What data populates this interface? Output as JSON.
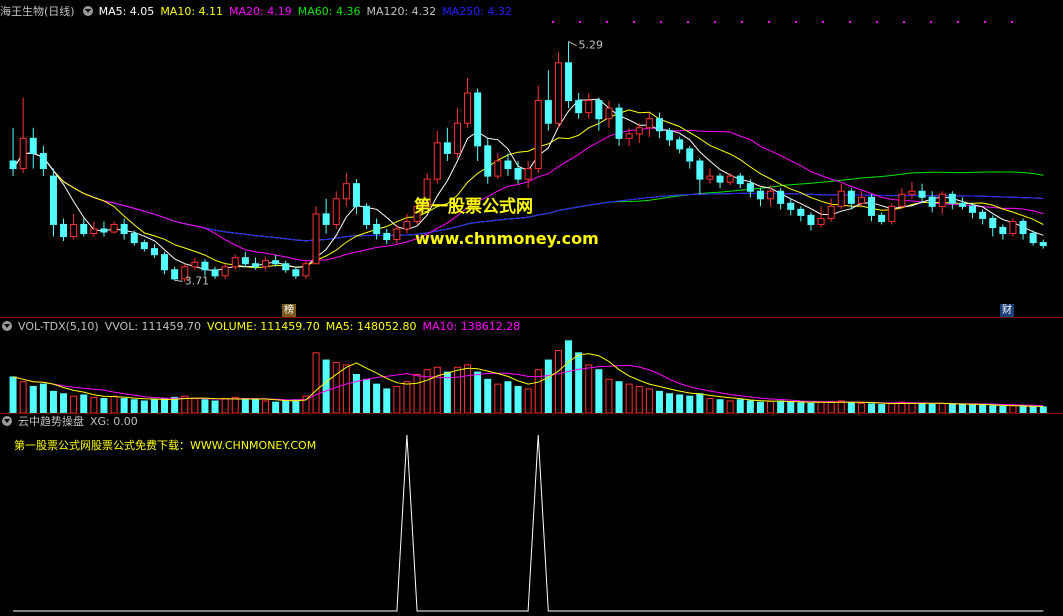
{
  "main_header": {
    "stock_name": "海王生物(日线)",
    "ma5": "MA5: 4.05",
    "ma10": "MA10: 4.11",
    "ma20": "MA20: 4.19",
    "ma60": "MA60: 4.36",
    "ma120": "MA120: 4.32",
    "ma250": "MA250: 4.32"
  },
  "volume_header": {
    "indicator": "VOL-TDX(5,10)",
    "vvol": "VVOL: 111459.70",
    "volume": "VOLUME: 111459.70",
    "ma5": "MA5: 148052.80",
    "ma10": "MA10: 138612.28"
  },
  "signal_header": {
    "indicator": "云中趋势操盘",
    "xg": "XG: 0.00",
    "promo": "第一股票公式网股票公式免费下载：WWW.CHNMONEY.COM"
  },
  "watermark": {
    "title": "第一股票公式网",
    "url": "www.chnmoney.com"
  },
  "tags": {
    "bang": "榜",
    "cai": "财"
  },
  "colors": {
    "up": "#ff3232",
    "down": "#54ffff",
    "ma5": "#ffffff",
    "ma10": "#ffff00",
    "ma20": "#ff00ff",
    "ma60": "#00e600",
    "ma120": "#c0c0c0",
    "ma250": "#2020ff",
    "divider": "#7a0000"
  },
  "chart_data": [
    {
      "type": "candlestick",
      "price_range": [
        3.58,
        5.42
      ],
      "annotations": [
        {
          "label": "5.29",
          "index": 55,
          "value": 5.29
        },
        {
          "label": "3.71",
          "index": 16,
          "value": 3.71
        }
      ],
      "candles": [
        [
          4.5,
          4.45,
          4.72,
          4.4
        ],
        [
          4.45,
          4.65,
          4.92,
          4.42
        ],
        [
          4.65,
          4.55,
          4.72,
          4.45
        ],
        [
          4.55,
          4.45,
          4.6,
          4.4
        ],
        [
          4.4,
          4.08,
          4.45,
          4.0
        ],
        [
          4.08,
          4.0,
          4.12,
          3.97
        ],
        [
          4.0,
          4.08,
          4.15,
          3.98
        ],
        [
          4.08,
          4.02,
          4.12,
          4.0
        ],
        [
          4.02,
          4.05,
          4.1,
          4.0
        ],
        [
          4.05,
          4.03,
          4.1,
          4.0
        ],
        [
          4.03,
          4.08,
          4.1,
          4.02
        ],
        [
          4.08,
          4.02,
          4.12,
          3.98
        ],
        [
          4.02,
          3.96,
          4.04,
          3.94
        ],
        [
          3.96,
          3.92,
          3.98,
          3.9
        ],
        [
          3.92,
          3.88,
          3.95,
          3.86
        ],
        [
          3.88,
          3.78,
          3.9,
          3.75
        ],
        [
          3.78,
          3.72,
          3.8,
          3.71
        ],
        [
          3.72,
          3.8,
          3.82,
          3.7
        ],
        [
          3.8,
          3.83,
          3.86,
          3.78
        ],
        [
          3.83,
          3.78,
          3.85,
          3.74
        ],
        [
          3.78,
          3.74,
          3.8,
          3.72
        ],
        [
          3.74,
          3.8,
          3.82,
          3.72
        ],
        [
          3.8,
          3.86,
          3.88,
          3.78
        ],
        [
          3.86,
          3.82,
          3.9,
          3.8
        ],
        [
          3.82,
          3.8,
          3.86,
          3.78
        ],
        [
          3.8,
          3.84,
          3.86,
          3.78
        ],
        [
          3.84,
          3.82,
          3.88,
          3.8
        ],
        [
          3.82,
          3.78,
          3.84,
          3.76
        ],
        [
          3.78,
          3.74,
          3.8,
          3.72
        ],
        [
          3.74,
          3.82,
          3.84,
          3.72
        ],
        [
          3.82,
          4.15,
          4.2,
          3.82
        ],
        [
          4.15,
          4.08,
          4.25,
          4.02
        ],
        [
          4.08,
          4.25,
          4.3,
          4.05
        ],
        [
          4.25,
          4.35,
          4.42,
          4.2
        ],
        [
          4.35,
          4.2,
          4.38,
          4.15
        ],
        [
          4.2,
          4.08,
          4.22,
          4.05
        ],
        [
          4.08,
          4.02,
          4.12,
          3.98
        ],
        [
          4.02,
          3.98,
          4.05,
          3.95
        ],
        [
          3.98,
          4.05,
          4.08,
          3.95
        ],
        [
          4.05,
          4.1,
          4.15,
          4.02
        ],
        [
          4.1,
          4.2,
          4.25,
          4.08
        ],
        [
          4.2,
          4.38,
          4.42,
          4.18
        ],
        [
          4.38,
          4.62,
          4.7,
          4.35
        ],
        [
          4.62,
          4.55,
          4.72,
          4.5
        ],
        [
          4.55,
          4.75,
          4.85,
          4.52
        ],
        [
          4.75,
          4.95,
          5.05,
          4.72
        ],
        [
          4.95,
          4.6,
          4.98,
          4.5
        ],
        [
          4.6,
          4.4,
          4.65,
          4.35
        ],
        [
          4.4,
          4.5,
          4.55,
          4.38
        ],
        [
          4.5,
          4.45,
          4.55,
          4.4
        ],
        [
          4.45,
          4.38,
          4.5,
          4.35
        ],
        [
          4.38,
          4.45,
          4.5,
          4.32
        ],
        [
          4.45,
          4.9,
          5.0,
          4.42
        ],
        [
          4.9,
          4.75,
          5.1,
          4.7
        ],
        [
          4.75,
          5.15,
          5.22,
          4.72
        ],
        [
          5.15,
          4.9,
          5.29,
          4.85
        ],
        [
          4.9,
          4.82,
          4.95,
          4.78
        ],
        [
          4.82,
          4.9,
          4.95,
          4.78
        ],
        [
          4.9,
          4.78,
          4.92,
          4.7
        ],
        [
          4.78,
          4.85,
          4.9,
          4.72
        ],
        [
          4.85,
          4.65,
          4.88,
          4.6
        ],
        [
          4.65,
          4.68,
          4.72,
          4.6
        ],
        [
          4.68,
          4.72,
          4.75,
          4.62
        ],
        [
          4.72,
          4.78,
          4.82,
          4.66
        ],
        [
          4.78,
          4.7,
          4.82,
          4.65
        ],
        [
          4.7,
          4.64,
          4.72,
          4.6
        ],
        [
          4.64,
          4.58,
          4.66,
          4.55
        ],
        [
          4.58,
          4.5,
          4.6,
          4.45
        ],
        [
          4.5,
          4.38,
          4.52,
          4.28
        ],
        [
          4.38,
          4.4,
          4.45,
          4.35
        ],
        [
          4.4,
          4.36,
          4.42,
          4.32
        ],
        [
          4.36,
          4.4,
          4.42,
          4.34
        ],
        [
          4.4,
          4.35,
          4.42,
          4.32
        ],
        [
          4.35,
          4.3,
          4.38,
          4.26
        ],
        [
          4.3,
          4.25,
          4.32,
          4.2
        ],
        [
          4.25,
          4.3,
          4.34,
          4.2
        ],
        [
          4.3,
          4.22,
          4.32,
          4.18
        ],
        [
          4.22,
          4.18,
          4.25,
          4.14
        ],
        [
          4.18,
          4.14,
          4.2,
          4.1
        ],
        [
          4.14,
          4.08,
          4.16,
          4.04
        ],
        [
          4.08,
          4.12,
          4.2,
          4.06
        ],
        [
          4.12,
          4.2,
          4.25,
          4.1
        ],
        [
          4.2,
          4.3,
          4.35,
          4.18
        ],
        [
          4.3,
          4.22,
          4.32,
          4.18
        ],
        [
          4.22,
          4.26,
          4.3,
          4.2
        ],
        [
          4.26,
          4.14,
          4.28,
          4.1
        ],
        [
          4.14,
          4.1,
          4.16,
          4.08
        ],
        [
          4.1,
          4.2,
          4.22,
          4.08
        ],
        [
          4.2,
          4.28,
          4.32,
          4.18
        ],
        [
          4.28,
          4.3,
          4.36,
          4.25
        ],
        [
          4.3,
          4.26,
          4.35,
          4.22
        ],
        [
          4.26,
          4.2,
          4.3,
          4.16
        ],
        [
          4.2,
          4.28,
          4.3,
          4.15
        ],
        [
          4.28,
          4.22,
          4.3,
          4.18
        ],
        [
          4.22,
          4.2,
          4.26,
          4.18
        ],
        [
          4.2,
          4.16,
          4.22,
          4.12
        ],
        [
          4.16,
          4.12,
          4.18,
          4.08
        ],
        [
          4.12,
          4.06,
          4.14,
          4.0
        ],
        [
          4.06,
          4.02,
          4.08,
          3.98
        ],
        [
          4.02,
          4.1,
          4.12,
          4.0
        ],
        [
          4.1,
          4.02,
          4.12,
          3.98
        ],
        [
          4.02,
          3.96,
          4.04,
          3.94
        ],
        [
          3.96,
          3.94,
          3.98,
          3.92
        ]
      ]
    },
    {
      "type": "bar",
      "series": "volume",
      "range": [
        0,
        320000
      ],
      "values": [
        150000,
        130000,
        110000,
        120000,
        90000,
        80000,
        70000,
        75000,
        65000,
        60000,
        70000,
        60000,
        55000,
        50000,
        55000,
        60000,
        65000,
        70000,
        60000,
        55000,
        50000,
        60000,
        65000,
        60000,
        55000,
        50000,
        45000,
        50000,
        55000,
        70000,
        250000,
        220000,
        210000,
        200000,
        160000,
        140000,
        120000,
        100000,
        110000,
        130000,
        160000,
        180000,
        190000,
        170000,
        190000,
        200000,
        170000,
        140000,
        120000,
        130000,
        110000,
        100000,
        180000,
        220000,
        260000,
        300000,
        250000,
        200000,
        180000,
        140000,
        130000,
        120000,
        110000,
        100000,
        90000,
        80000,
        75000,
        70000,
        80000,
        60000,
        55000,
        50000,
        55000,
        50000,
        45000,
        48000,
        50000,
        45000,
        42000,
        40000,
        45000,
        48000,
        50000,
        42000,
        40000,
        38000,
        35000,
        40000,
        45000,
        42000,
        38000,
        36000,
        40000,
        38000,
        35000,
        33000,
        32000,
        30000,
        28000,
        30000,
        28000,
        26000,
        25000
      ]
    },
    {
      "type": "line",
      "series": "XG",
      "range": [
        0,
        1
      ],
      "spikes": [
        39,
        52
      ]
    }
  ]
}
